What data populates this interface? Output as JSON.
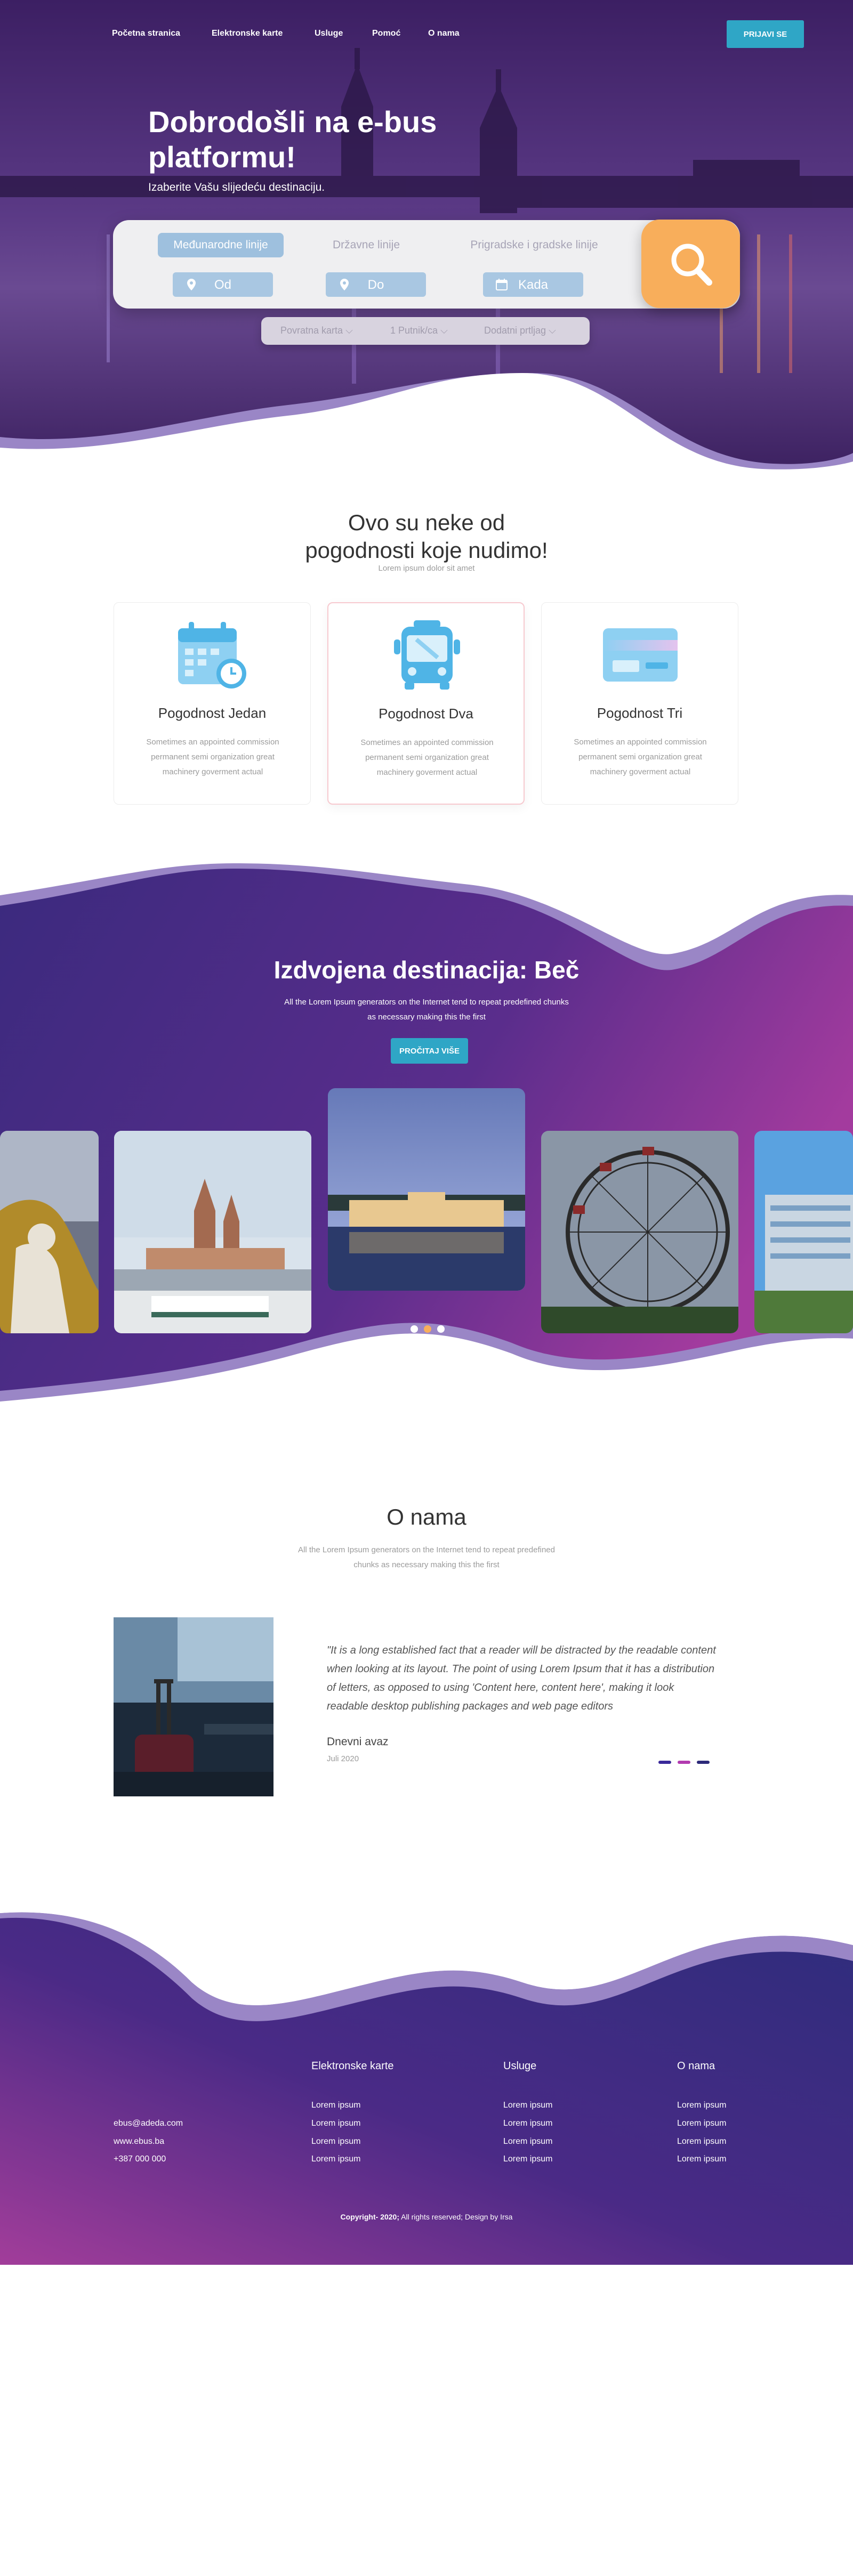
{
  "nav": {
    "items": [
      "Početna stranica",
      "Elektronske karte",
      "Usluge",
      "Pomoć",
      "O nama"
    ],
    "login": "PRIJAVI SE"
  },
  "hero": {
    "title": "Dobrodošli na e-bus platformu!",
    "subtitle": "Izaberite Vašu slijedeću destinaciju.",
    "tabs": [
      "Međunarodne linije",
      "Državne linije",
      "Prigradske i gradske linije"
    ],
    "fields": [
      "Od",
      "Do",
      "Kada"
    ],
    "options": [
      "Povratna karta",
      "1 Putnik/ca",
      "Dodatni prtljag"
    ]
  },
  "features": {
    "title": "Ovo su neke od pogodnosti koje nudimo!",
    "lead": "Lorem ipsum dolor sit amet",
    "cards": [
      {
        "title": "Pogodnost Jedan",
        "desc": "Sometimes an appointed commission permanent semi organization great machinery goverment actual"
      },
      {
        "title": "Pogodnost Dva",
        "desc": "Sometimes an appointed commission permanent semi organization great machinery goverment actual"
      },
      {
        "title": "Pogodnost Tri",
        "desc": "Sometimes an appointed commission permanent semi organization great machinery goverment actual"
      }
    ]
  },
  "destination": {
    "title": "Izdvojena destinacija: Beč",
    "desc": "All the Lorem Ipsum generators on the Internet tend to repeat predefined chunks as necessary making this the first",
    "button": "PROČITAJ VIŠE"
  },
  "about": {
    "title": "O nama",
    "desc": "All the Lorem Ipsum generators on the Internet tend to repeat predefined chunks as necessary making this the first",
    "quote": "\"It is a long established fact that a reader will be distracted by the readable content when looking at its layout. The point of using Lorem Ipsum that it has a distribution of letters, as opposed to using 'Content here, content here', making it look readable desktop publishing packages and web page editors",
    "source": "Dnevni avaz",
    "date": "Juli 2020"
  },
  "footer": {
    "contact": [
      "ebus@adeda.com",
      "www.ebus.ba",
      "+387 000 000"
    ],
    "columns": [
      {
        "title": "Elektronske karte",
        "links": [
          "Lorem ipsum",
          "Lorem ipsum",
          "Lorem ipsum",
          "Lorem ipsum"
        ]
      },
      {
        "title": "Usluge",
        "links": [
          "Lorem ipsum",
          "Lorem ipsum",
          "Lorem ipsum",
          "Lorem ipsum"
        ]
      },
      {
        "title": "O nama",
        "links": [
          "Lorem ipsum",
          "Lorem ipsum",
          "Lorem ipsum",
          "Lorem ipsum"
        ]
      }
    ],
    "copyright_bold": "Copyright- 2020;",
    "copyright_rest": " All rights reserved; Design by Irsa"
  },
  "colors": {
    "accent": "#2fa6c6",
    "search": "#f8ae5b",
    "purple_dark": "#3a2a7a",
    "purple_light": "#a23d9a",
    "pager": [
      "#3a2a9a",
      "#b23bb0",
      "#2d2a7a"
    ]
  }
}
